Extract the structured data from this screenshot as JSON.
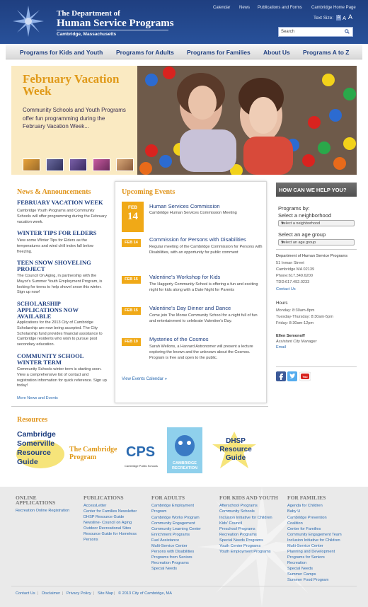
{
  "header": {
    "dept_line1": "The Department of",
    "dept_line2": "Human Service Programs",
    "dept_line3": "Cambridge, Massachusetts",
    "utility_links": [
      "Calendar",
      "News",
      "Publications and Forms",
      "Cambridge Home Page"
    ],
    "text_size_label": "Text Size:",
    "text_size_options": [
      "A",
      "A",
      "A"
    ],
    "search_placeholder": "Search",
    "brand_color": "#1f3f80"
  },
  "nav": {
    "items": [
      "Programs for Kids and Youth",
      "Programs for Adults",
      "Programs for Families",
      "About Us",
      "Programs A to Z"
    ]
  },
  "hero": {
    "title": "February Vacation Week",
    "body": "Community Schools and Youth Programs offer fun programming during the February Vacation Week..."
  },
  "news": {
    "heading": "News & Announcements",
    "items": [
      {
        "title": "FEBRUARY VACATION WEEK",
        "body": "Cambridge Youth Programs and Community Schools will offer programming during the February vacation week."
      },
      {
        "title": "WINTER TIPS FOR ELDERS",
        "body": "View some Winter Tips for Elders as the temperatures and wind chill index fall below freezing."
      },
      {
        "title": "TEEN SNOW SHOVELING PROJECT",
        "body": "The Council On Aging, in partnership with the Mayor's Summer Youth Employment Program, is looking for teens to help shovel snow this winter. Sign up now!"
      },
      {
        "title": "SCHOLARSHIP APPLICATIONS NOW AVAILABLE",
        "body": "Applications for the 2013 City of Cambridge Scholarship are now being accepted. The City Scholarship fund provides financial assistance to Cambridge residents who wish to pursue post secondary education."
      },
      {
        "title": "COMMUNITY SCHOOL WINTER TERM",
        "body": "Community Schools winter term is starting soon. View a comprehensive list of contact and registration information for quick reference. Sign up today!"
      }
    ],
    "more": "More News and Events"
  },
  "events": {
    "heading": "Upcoming Events",
    "featured_month": "FEB",
    "featured_day": "14",
    "items": [
      {
        "date": "",
        "title": "Human Services Commission",
        "body": "Cambridge Human Services Commission Meeting"
      },
      {
        "date": "FEB 14",
        "title": "Commission for Persons with Disabilities",
        "body": "Regular meeting of the Cambridge Commission for Persons with Disabilities, with an opportunity for public comment"
      },
      {
        "date": "FEB 15",
        "title": "Valentine's Workshop for Kids",
        "body": "The Haggerty Community School is offering a fun and exciting night for kids along with a Date Night for Parents"
      },
      {
        "date": "FEB 15",
        "title": "Valentine's Day Dinner and Dance",
        "body": "Come join The Morse Community School for a night full of fun and entertainment to celebrate Valentine's Day."
      },
      {
        "date": "FEB 19",
        "title": "Mysteries of the Cosmos",
        "body": "Sarah Wellons, a Harvard Astronomer will present a lecture exploring the known and the unknown about the Cosmos. Program is free and open to the public."
      }
    ],
    "view_all": "View Events Calendar »"
  },
  "help": {
    "heading": "HOW CAN WE HELP YOU?",
    "programs_by": "Programs by:",
    "select_neighborhood_label": "Select a neighborhood",
    "select_neighborhood_value": "Select a neighborhood",
    "select_age_label": "Select an age group",
    "select_age_value": "Select an age group",
    "address_lines": [
      "Department of Human Service Programs",
      "51 Inman Street",
      "Cambridge MA 02139",
      "Phone:617.349.6200",
      "TDD:617.492.0233"
    ],
    "contact_link": "Contact Us",
    "hours_heading": "Hours",
    "hours_lines": [
      "Monday: 8:30am-8pm",
      "Tuesday-Thursday: 8:30am-5pm",
      "Friday: 8:30am-12pm"
    ],
    "manager_name": "Ellen Semonoff",
    "manager_title": "Assistant City Manager",
    "email_link": "Email"
  },
  "resources": {
    "heading": "Resources",
    "logos": [
      "Cambridge Somerville Resource Guide",
      "The Cambridge Program",
      "CPS",
      "Cambridge Public Schools",
      "CAMBRIDGE RECREATION",
      "DHSP Resource Guide"
    ]
  },
  "footer": {
    "columns": [
      {
        "heading": [
          "ONLINE",
          "APPLICATIONS"
        ],
        "links": [
          "Recreation Online Registration"
        ]
      },
      {
        "heading": [
          "PUBLICATIONS"
        ],
        "links": [
          "AccessLetter",
          "Center for Families Newsletter",
          "DHSP Resource Guide",
          "Newsline- Council on Aging",
          "Outdoor Recreational Sites",
          "Resource Guide for Homeless",
          "Persons"
        ]
      },
      {
        "heading": [
          "FOR ADULTS"
        ],
        "links": [
          "Cambridge Employment",
          "Program",
          "Cambridge Works Program",
          "Community Engagement",
          "Community Learning Center",
          "Enrichment Programs",
          "Fuel Assistance",
          "Multi-Service Center",
          "Persons with Disabilities",
          "Programs from Seniors",
          "Recreation Programs",
          "Special Needs"
        ]
      },
      {
        "heading": [
          "FOR KIDS AND YOUTH"
        ],
        "links": [
          "Afterschool Programs",
          "Community Schools",
          "Inclusion Initiative for Children",
          "Kids' Council",
          "Preschool Programs",
          "Recreation Programs",
          "Special Needs Programs",
          "Youth Center Programs",
          "Youth Employment Programs"
        ]
      },
      {
        "heading": [
          "FOR FAMILIES"
        ],
        "links": [
          "Agenda for Children",
          "Baby U",
          "Cambridge Prevention",
          "Coalition",
          "Center for Families",
          "Community Engagement Team",
          "Inclusion Initiative for Children",
          "Multi-Service Center",
          "Planning and Development",
          "Programs for Seniors",
          "Recreation",
          "Special Needs",
          "Summer Camps",
          "Summer Food Program"
        ]
      }
    ],
    "bottom_links": [
      "Contact Us",
      "Disclaimer",
      "Privacy Policy",
      "Site Map"
    ],
    "copyright": "© 2013 City of Cambridge, MA"
  },
  "colors": {
    "accent": "#e0941a",
    "link": "#2a6ab0",
    "nav_text": "#1f3f80"
  }
}
